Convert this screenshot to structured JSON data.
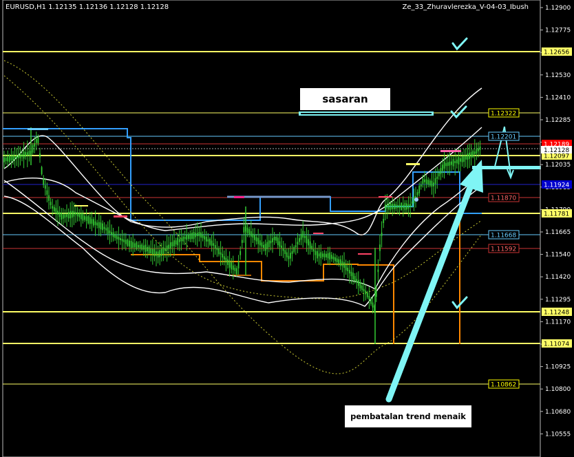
{
  "header": {
    "symbol_info": "EURUSD,H1  1.12135 1.12136 1.12128 1.12128",
    "indicator_name": "Ze_33_Zhuravlerezka_V-04-03_Ibush"
  },
  "annotations": {
    "target_label": "sasaran",
    "reversal_label": "pembatalan trend menaik"
  },
  "price_axis": {
    "ticks": [
      "1.12900",
      "1.12775",
      "1.12655",
      "1.12530",
      "1.12410",
      "1.12285",
      "1.12160",
      "1.12035",
      "1.11915",
      "1.11790",
      "1.11665",
      "1.11540",
      "1.11420",
      "1.11295",
      "1.11170",
      "1.11045",
      "1.10925",
      "1.10800",
      "1.10680",
      "1.10555"
    ],
    "current_price": "1.12128",
    "level_labels": [
      {
        "text": "1.12656",
        "bg": "#ffff66",
        "fg": "#000000"
      },
      {
        "text": "1.12322",
        "bg": "#000000",
        "fg": "#ffff00",
        "border": "#ffff00"
      },
      {
        "text": "1.12201",
        "bg": "#000000",
        "fg": "#66ccff",
        "border": "#66ccff"
      },
      {
        "text": "1.12189",
        "bg": "#ff0000",
        "fg": "#ffffff"
      },
      {
        "text": "1.12097",
        "bg": "#ffff66",
        "fg": "#000000"
      },
      {
        "text": "1.11924",
        "bg": "#0000cc",
        "fg": "#ffffff"
      },
      {
        "text": "1.11870",
        "bg": "#000000",
        "fg": "#ff6666",
        "border": "#cc3333"
      },
      {
        "text": "1.11781",
        "bg": "#ffff66",
        "fg": "#000000"
      },
      {
        "text": "1.11668",
        "bg": "#000000",
        "fg": "#66ccff",
        "border": "#66ccff"
      },
      {
        "text": "1.11592",
        "bg": "#000000",
        "fg": "#ff6666",
        "border": "#cc3333"
      },
      {
        "text": "1.11248",
        "bg": "#ffff66",
        "fg": "#000000"
      },
      {
        "text": "1.11074",
        "bg": "#ffff66",
        "fg": "#000000"
      },
      {
        "text": "1.10862",
        "bg": "#000000",
        "fg": "#ffff00",
        "border": "#ffff00"
      }
    ]
  },
  "colors": {
    "background": "#000000",
    "candles": "#33cc33",
    "band": "#ffffff",
    "support_resistance": "#ffff66",
    "cyan_accent": "#7ff5f5",
    "stop_line": "#ff8800",
    "trail_line": "#33a0ff"
  },
  "icons": [
    "checkmark-icon",
    "arrow-up-icon",
    "arrow-down-icon"
  ]
}
